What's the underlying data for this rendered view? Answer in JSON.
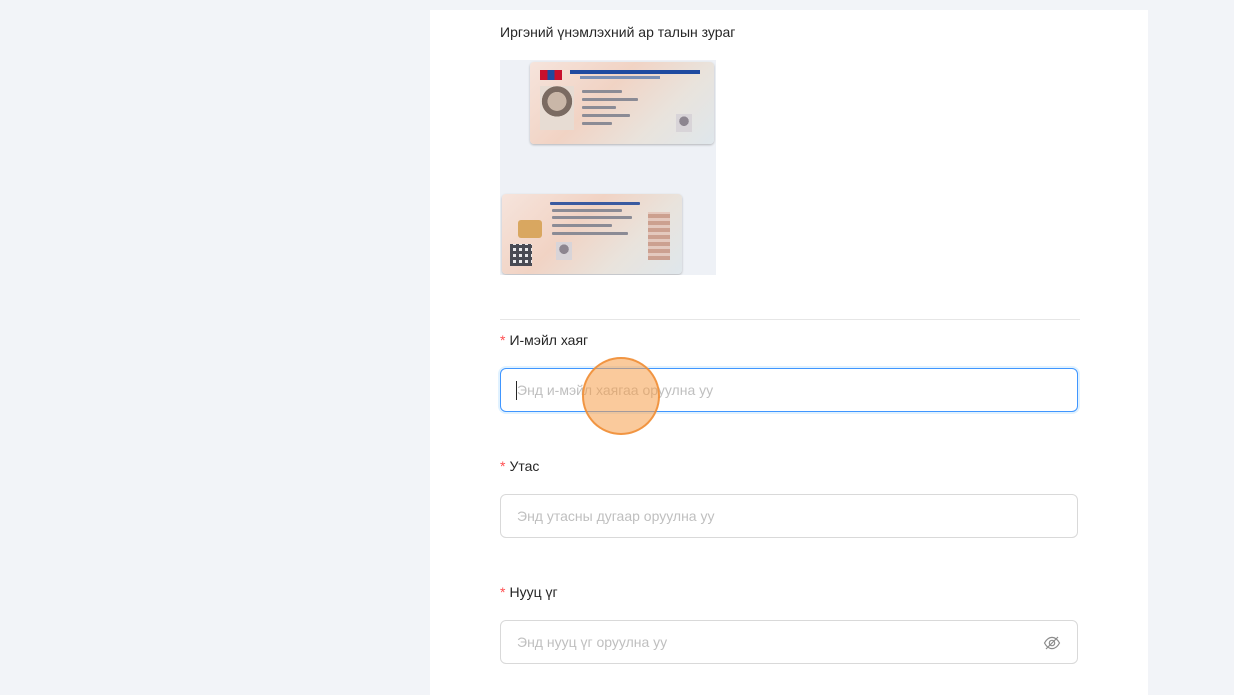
{
  "id_section": {
    "label": "Иргэний үнэмлэхний ар талын зураг"
  },
  "form": {
    "email": {
      "label": "И-мэйл хаяг",
      "placeholder": "Энд и-мэйл хаягаа  оруулна уу",
      "required_mark": "*"
    },
    "phone": {
      "label": "Утас",
      "placeholder": "Энд утасны дугаар оруулна уу",
      "required_mark": "*"
    },
    "password": {
      "label": "Нууц үг",
      "placeholder": "Энд нууц үг оруулна уу",
      "required_mark": "*"
    }
  },
  "icons": {
    "password_toggle": "eye-invisible-icon"
  },
  "colors": {
    "required": "#ff4d4f",
    "focus_border": "#4096ff",
    "click_indicator": "#f6a04a"
  }
}
